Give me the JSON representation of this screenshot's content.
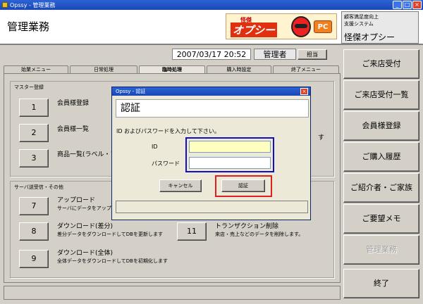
{
  "window": {
    "title": "Opssy - 管理業務",
    "min": "_",
    "max": "□",
    "close": "×"
  },
  "header": {
    "page_title": "管理業務",
    "logo": {
      "small": "怪傑",
      "big": "オプシー",
      "pc": "PC"
    },
    "system": {
      "line1": "顧客満足度向上",
      "line2": "支援システム",
      "name": "怪傑オプシー"
    }
  },
  "info": {
    "date": "2007/03/17 20:52",
    "user": "管理者",
    "tanto": "担当"
  },
  "tabs": [
    "始業メニュー",
    "日常処理",
    "臨時処理",
    "購入時設定",
    "終了メニュー"
  ],
  "active_tab": "臨時処理",
  "master": {
    "label": "マスター登録",
    "items": [
      {
        "num": "1",
        "label": "会員様登録"
      },
      {
        "num": "2",
        "label": "会員様一覧"
      },
      {
        "num": "3",
        "label": "商品一覧(ラベル・プ"
      }
    ],
    "side_hint": "す"
  },
  "server": {
    "label": "サーバ送受信・その他",
    "items": [
      {
        "num": "7",
        "label": "アップロード",
        "desc": "サーバにデータをアップロ"
      },
      {
        "num": "8",
        "label": "ダウンロード(差分)",
        "desc": "差分データをダウンロードしてDBを更新します"
      },
      {
        "num": "9",
        "label": "ダウンロード(全体)",
        "desc": "全体データをダウンロードしてDBを初期化します"
      },
      {
        "num": "11",
        "label": "トランザクション削除",
        "desc": "来店・売上などのデータを削除します。"
      }
    ]
  },
  "right_menu": [
    "ご来店受付",
    "ご来店受付一覧",
    "会員様登録",
    "ご購入履歴",
    "ご紹介者・ご家族",
    "ご要望メモ",
    "管理業務",
    "終了"
  ],
  "dialog": {
    "title": "Opssy - 認証",
    "heading": "認証",
    "message": "ID およびパスワードを入力して下さい。",
    "id_label": "ID",
    "password_label": "パスワード",
    "id_value": "",
    "password_value": "",
    "cancel": "キャンセル",
    "ok": "認証",
    "close": "×"
  }
}
